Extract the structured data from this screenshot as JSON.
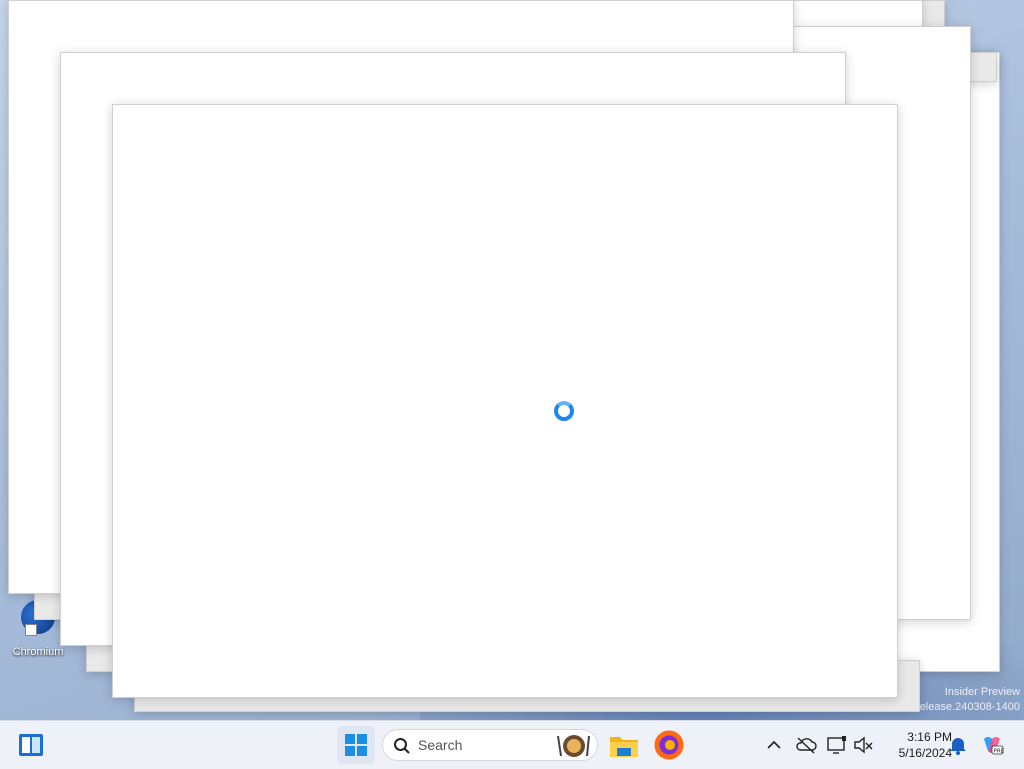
{
  "desktop": {
    "icon_label": "Chromium",
    "watermark_line1": "Insider Preview",
    "watermark_line2": "elease.240308-1400"
  },
  "loading_indicator": {
    "color": "#1e88e5"
  },
  "taskbar": {
    "search_placeholder": "Search",
    "apps": [
      "File Explorer",
      "Firefox"
    ],
    "icons": [
      "widgets-icon",
      "start-icon",
      "search-icon",
      "file-explorer-icon",
      "firefox-icon",
      "chevron-up-icon",
      "onedrive-offline-icon",
      "network-icon",
      "volume-muted-icon",
      "notification-bell-icon",
      "copilot-icon"
    ]
  },
  "clock": {
    "time": "3:16 PM",
    "date": "5/16/2024"
  }
}
